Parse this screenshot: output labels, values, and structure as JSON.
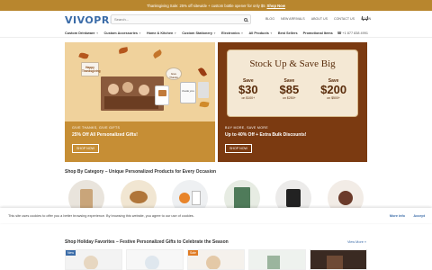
{
  "promo": {
    "text": "Thanksgiving Sale: 25% off sitewide + custom bottle opener for only $5",
    "link": "Shop Now"
  },
  "brand": {
    "name_main": "VIVO",
    "name_sub": "PRINT"
  },
  "search": {
    "placeholder": "Search...",
    "value": ""
  },
  "top_links": [
    "Blog",
    "New Arrivals",
    "About Us",
    "Contact Us",
    "Login"
  ],
  "nav": {
    "items": [
      "Custom Drinkware",
      "Custom Accessories",
      "Home & Kitchen",
      "Custom Stationery",
      "Electronics",
      "All Products",
      "Best Sellers",
      "Promotional Items"
    ],
    "phone": "+1 877 838 4991"
  },
  "hero": {
    "left": {
      "caption_small": "Give Thanks, Give Gifts",
      "caption_big": "25% Off All Personalized Gifts!",
      "button": "Shop Now",
      "card_texts": [
        "Happy Thanksgiving",
        "thank you",
        "Give Thanks"
      ]
    },
    "right": {
      "title": "Stock Up & Save Big",
      "deals": [
        {
          "label": "Save",
          "amount": "$30",
          "condition": "on $100+"
        },
        {
          "label": "Save",
          "amount": "$85",
          "condition": "on $250+"
        },
        {
          "label": "Save",
          "amount": "$200",
          "condition": "on $500+"
        }
      ],
      "caption_small": "Buy More, Save More",
      "caption_big": "Up to 40% Off + Extra Bulk Discounts!",
      "button": "Shop Now"
    }
  },
  "categories_section": {
    "title": "Shop By Category – Unique Personalized Products for Every Occasion",
    "items": [
      "Custom Drinkware",
      "Custom Accessories",
      "Home & Kitchen",
      "Custom Stationery",
      "Electronics",
      "New Arrivals"
    ]
  },
  "cookie": {
    "text": "This site uses cookies to offer you a better browsing experience. By browsing this website, you agree to our use of cookies.",
    "more": "More info",
    "accept": "Accept"
  },
  "holiday_section": {
    "title": "Shop Holiday Favorites – Festive Personalized Gifts to Celebrate the Season",
    "view_more": "View More »",
    "badges": [
      "New",
      "Sale"
    ]
  },
  "colors": {
    "promo_bar": "#b8862e",
    "brand_blue": "#3b6ca8",
    "hero_left_caption": "#c68e35",
    "hero_right": "#7b3a11",
    "sale_badge": "#e07b24",
    "new_badge": "#3b6ca8"
  }
}
